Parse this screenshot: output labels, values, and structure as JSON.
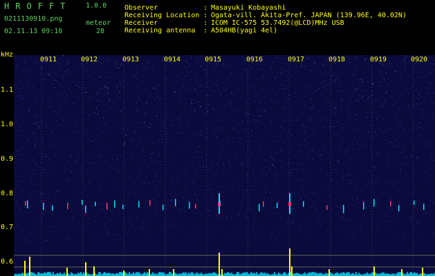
{
  "header": {
    "app_title": "HROFFT",
    "version": "1.0.0",
    "filename": "0211130910.png",
    "datetime": "02.11.13 09:10",
    "meteor_label": "meteor",
    "meteor_count": "28",
    "fields": [
      {
        "label": "Observer",
        "sep": ":",
        "value": "Masayuki Kobayashi"
      },
      {
        "label": "Receiving Location",
        "sep": ":",
        "value": "Ogata-vill. Akita-Pref. JAPAN (139.96E, 40.02N)"
      },
      {
        "label": "Receiver",
        "sep": ":",
        "value": "ICOM IC-575 53.7492(@LCD)MHz USB"
      },
      {
        "label": "Receiving antenna",
        "sep": ":",
        "value": "A504HB(yagi 4el)"
      }
    ]
  },
  "spectrogram": {
    "y_unit": "kHz",
    "y_ticks": [
      "1.1",
      "1.0",
      "0.9",
      "0.8",
      "0.7",
      "0.6"
    ],
    "x_ticks": [
      "0911",
      "0912",
      "0913",
      "0914",
      "0915",
      "0916",
      "0917",
      "0918",
      "0919",
      "0920"
    ],
    "colors": {
      "background": "#0a0a3c",
      "noise": "#3b4bd8",
      "axis_text": "#ffff00",
      "header_text": "#5fd35f",
      "trace": "#00e5ff",
      "peak": "#ffff00"
    }
  }
}
